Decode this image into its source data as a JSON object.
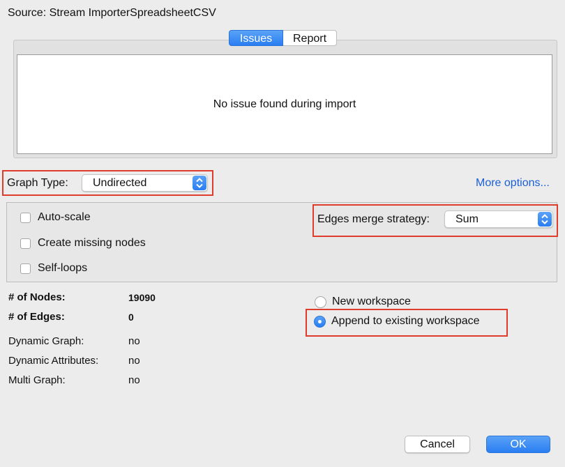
{
  "source": "Source:  Stream ImporterSpreadsheetCSV",
  "tabs": [
    "Issues",
    "Report"
  ],
  "issues_message": "No issue found during import",
  "graph_type": {
    "label": "Graph Type:",
    "value": "Undirected"
  },
  "more_options": "More options...",
  "options": {
    "auto_scale": "Auto-scale",
    "create_missing_nodes": "Create missing nodes",
    "self_loops": "Self-loops",
    "edges_merge_label": "Edges merge strategy:",
    "edges_merge_value": "Sum"
  },
  "stats": [
    {
      "label": "# of Nodes:",
      "value": "19090"
    },
    {
      "label": "# of Edges:",
      "value": "0"
    },
    {
      "label": "Dynamic Graph:",
      "value": "no"
    },
    {
      "label": "Dynamic Attributes:",
      "value": "no"
    },
    {
      "label": "Multi Graph:",
      "value": "no"
    }
  ],
  "workspace": {
    "new": "New workspace",
    "append": "Append to existing workspace",
    "selected": "append"
  },
  "buttons": {
    "cancel": "Cancel",
    "ok": "OK"
  },
  "colors": {
    "accent": "#2a7ef2",
    "highlight": "#e03c2c",
    "link": "#1a5fd6"
  }
}
